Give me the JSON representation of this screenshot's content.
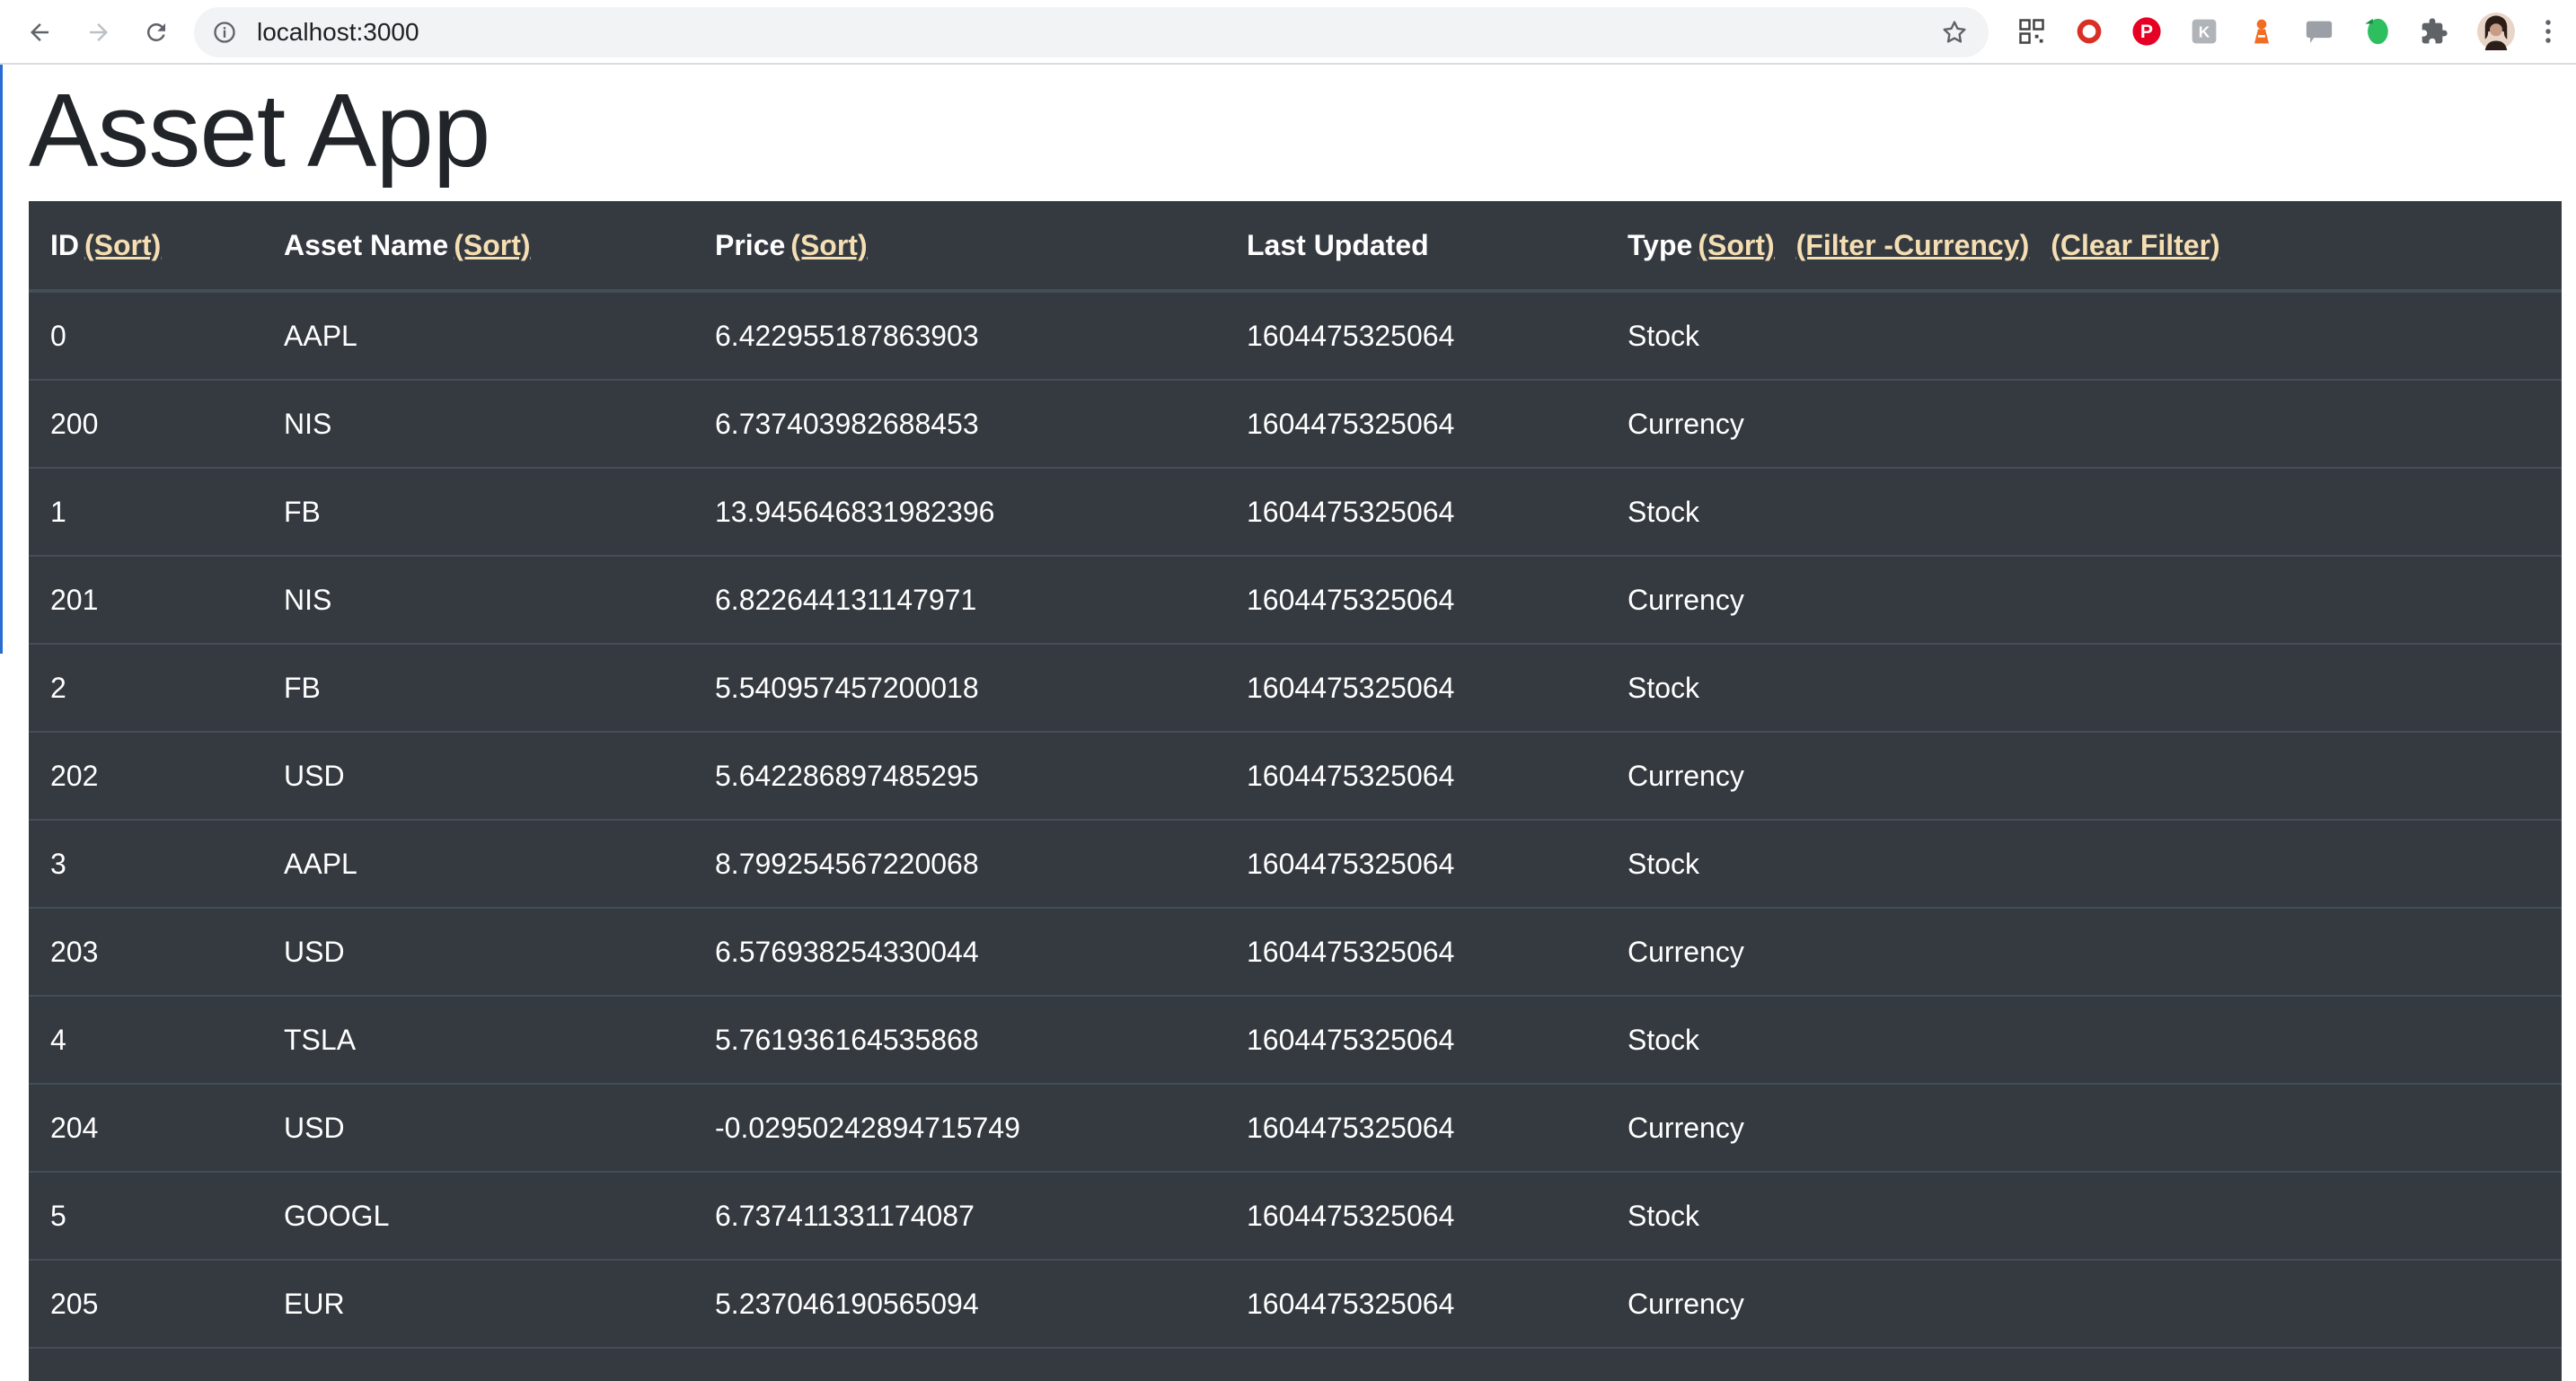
{
  "browser": {
    "url": "localhost:3000"
  },
  "page": {
    "title": "Asset App"
  },
  "table": {
    "headers": {
      "id": "ID",
      "name": "Asset Name",
      "price": "Price",
      "last_updated": "Last Updated",
      "type": "Type",
      "sort_label": "(Sort)",
      "filter_currency_label": "(Filter -Currency)",
      "clear_filter_label": "(Clear Filter)"
    },
    "rows": [
      {
        "id": "0",
        "name": "AAPL",
        "price": "6.422955187863903",
        "updated": "1604475325064",
        "type": "Stock"
      },
      {
        "id": "200",
        "name": "NIS",
        "price": "6.737403982688453",
        "updated": "1604475325064",
        "type": "Currency"
      },
      {
        "id": "1",
        "name": "FB",
        "price": "13.945646831982396",
        "updated": "1604475325064",
        "type": "Stock"
      },
      {
        "id": "201",
        "name": "NIS",
        "price": "6.822644131147971",
        "updated": "1604475325064",
        "type": "Currency"
      },
      {
        "id": "2",
        "name": "FB",
        "price": "5.540957457200018",
        "updated": "1604475325064",
        "type": "Stock"
      },
      {
        "id": "202",
        "name": "USD",
        "price": "5.642286897485295",
        "updated": "1604475325064",
        "type": "Currency"
      },
      {
        "id": "3",
        "name": "AAPL",
        "price": "8.799254567220068",
        "updated": "1604475325064",
        "type": "Stock"
      },
      {
        "id": "203",
        "name": "USD",
        "price": "6.576938254330044",
        "updated": "1604475325064",
        "type": "Currency"
      },
      {
        "id": "4",
        "name": "TSLA",
        "price": "5.761936164535868",
        "updated": "1604475325064",
        "type": "Stock"
      },
      {
        "id": "204",
        "name": "USD",
        "price": "-0.02950242894715749",
        "updated": "1604475325064",
        "type": "Currency"
      },
      {
        "id": "5",
        "name": "GOOGL",
        "price": "6.737411331174087",
        "updated": "1604475325064",
        "type": "Stock"
      },
      {
        "id": "205",
        "name": "EUR",
        "price": "5.237046190565094",
        "updated": "1604475325064",
        "type": "Currency"
      },
      {
        "id": "",
        "name": "",
        "price": "",
        "updated": "",
        "type": ""
      }
    ]
  },
  "colors": {
    "table_bg": "#343a40",
    "link": "#f5deb3",
    "accent": "#2a6bd1"
  }
}
